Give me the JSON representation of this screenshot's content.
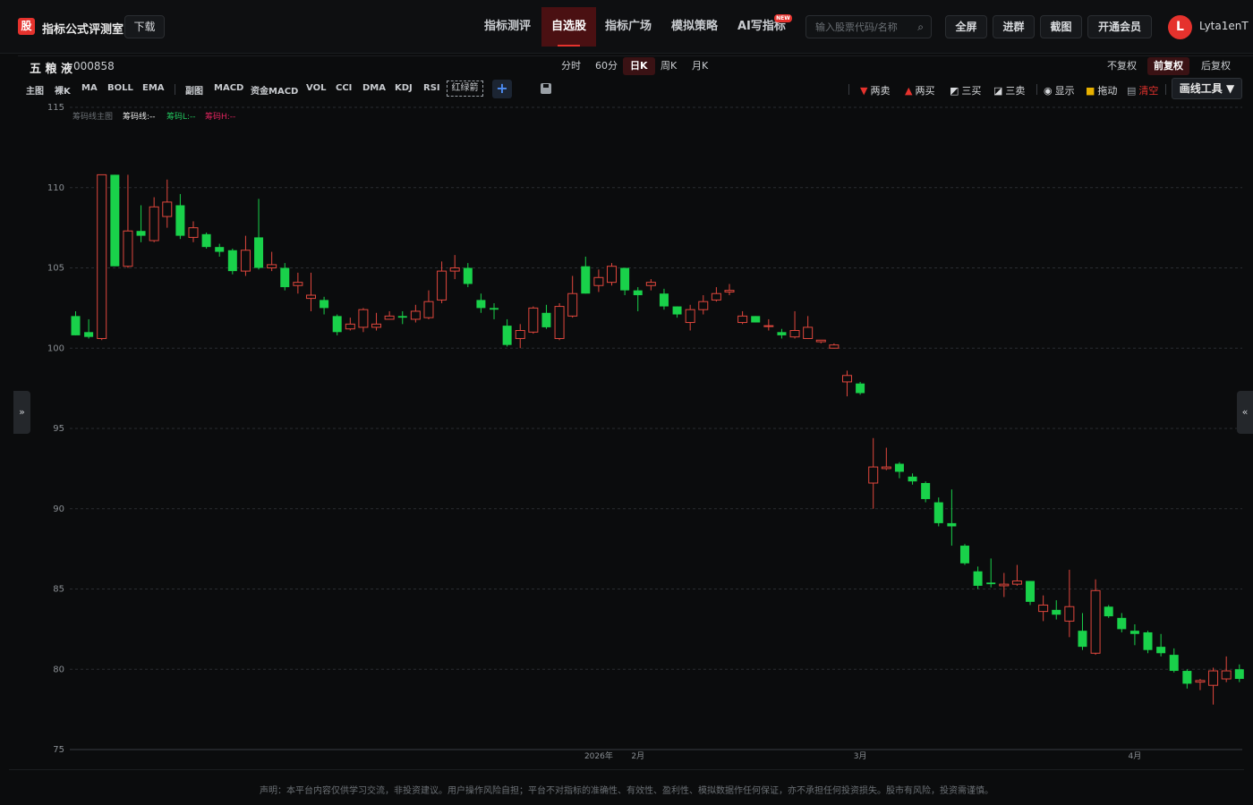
{
  "app": {
    "logo": "股",
    "title": "指标公式评测室",
    "download": "下载"
  },
  "nav": [
    {
      "label": "指标测评",
      "active": false
    },
    {
      "label": "自选股",
      "active": true
    },
    {
      "label": "指标广场",
      "active": false
    },
    {
      "label": "模拟策略",
      "active": false
    },
    {
      "label": "AI写指标",
      "active": false,
      "badge": "NEW"
    }
  ],
  "search": {
    "placeholder": "输入股票代码/名称"
  },
  "top_buttons": [
    "全屏",
    "进群",
    "截图",
    "开通会员"
  ],
  "user": {
    "initial": "L",
    "name": "Lyta1enT"
  },
  "stock": {
    "name": "五 粮 液",
    "code": "000858"
  },
  "periods": [
    {
      "label": "分时",
      "active": false
    },
    {
      "label": "60分",
      "active": false
    },
    {
      "label": "日K",
      "active": true
    },
    {
      "label": "周K",
      "active": false
    },
    {
      "label": "月K",
      "active": false
    }
  ],
  "adjust": [
    {
      "label": "不复权",
      "active": false
    },
    {
      "label": "前复权",
      "active": true
    },
    {
      "label": "后复权",
      "active": false
    }
  ],
  "indicators_main": [
    "主图",
    "裸K",
    "MA",
    "BOLL",
    "EMA"
  ],
  "indicators_sub": [
    "副图",
    "MACD",
    "资金MACD",
    "VOL",
    "CCI",
    "DMA",
    "KDJ",
    "RSI"
  ],
  "redgreen_label": "红绿箭",
  "plus_label": "+",
  "tools": [
    {
      "glyph": "▼",
      "color": "#e5322d",
      "label": "两卖"
    },
    {
      "glyph": "▲",
      "color": "#e5322d",
      "label": "两买"
    },
    {
      "glyph": "◩",
      "color": "#d7d9dc",
      "label": "三买"
    },
    {
      "glyph": "◪",
      "color": "#d7d9dc",
      "label": "三卖"
    },
    {
      "glyph": "◉",
      "color": "#d7d9dc",
      "label": "显示"
    },
    {
      "glyph": "🔒",
      "color": "#e8b100",
      "label": "拖动"
    },
    {
      "glyph": "🗑",
      "color": "#9aa0a6",
      "label": "清空",
      "label_color": "#e5322d"
    }
  ],
  "draw_tool": "画线工具 ▼",
  "side_left": "»",
  "side_right": "«",
  "legend": [
    {
      "label": "筹码线主图",
      "color": "#6b7075"
    },
    {
      "label": "筹码线:--",
      "color": "#e8e8e8"
    },
    {
      "label": "筹码L:--",
      "color": "#22c55e"
    },
    {
      "label": "筹码H:--",
      "color": "#e0245e"
    }
  ],
  "disclaimer": "声明：本平台内容仅供学习交流，非投资建议。用户操作风险自担；平台不对指标的准确性、有效性、盈利性、模拟数据作任何保证，亦不承担任何投资损失。股市有风险，投资需谨慎。",
  "colors": {
    "up": "#e0473d",
    "down": "#19d14a",
    "grid": "#2a2d31",
    "axis_text": "#8a8f94"
  },
  "chart_data": {
    "type": "candlestick",
    "y_ticks": [
      115,
      110,
      105,
      100,
      95,
      90,
      85,
      80,
      75
    ],
    "ylim": [
      75,
      115
    ],
    "x_labels": [
      {
        "index": 40,
        "label": "2026年"
      },
      {
        "index": 43,
        "label": "2月"
      },
      {
        "index": 60,
        "label": "3月"
      },
      {
        "index": 81,
        "label": "4月"
      }
    ],
    "candles": [
      [
        102.0,
        100.8,
        102.3,
        100.8
      ],
      [
        101.0,
        100.7,
        101.8,
        100.6
      ],
      [
        100.6,
        110.8,
        110.8,
        100.5
      ],
      [
        110.8,
        105.1,
        110.8,
        105.1
      ],
      [
        105.1,
        107.3,
        110.8,
        105.0
      ],
      [
        107.3,
        107.0,
        108.9,
        106.6
      ],
      [
        106.7,
        108.8,
        109.4,
        106.6
      ],
      [
        108.2,
        109.1,
        110.5,
        107.5
      ],
      [
        108.9,
        107.0,
        109.6,
        106.8
      ],
      [
        106.9,
        107.5,
        107.9,
        106.6
      ],
      [
        107.1,
        106.3,
        107.2,
        106.2
      ],
      [
        106.3,
        106.0,
        106.5,
        105.7
      ],
      [
        106.1,
        104.8,
        106.2,
        104.6
      ],
      [
        104.8,
        106.1,
        107.0,
        104.5
      ],
      [
        106.9,
        105.0,
        109.3,
        104.9
      ],
      [
        105.0,
        105.2,
        106.0,
        104.8
      ],
      [
        105.0,
        103.8,
        105.3,
        103.6
      ],
      [
        103.9,
        104.1,
        104.7,
        103.4
      ],
      [
        103.1,
        103.3,
        104.7,
        102.3
      ],
      [
        103.0,
        102.5,
        103.2,
        102.1
      ],
      [
        102.0,
        101.0,
        102.1,
        100.8
      ],
      [
        101.2,
        101.5,
        101.9,
        101.1
      ],
      [
        101.3,
        102.4,
        102.5,
        101.0
      ],
      [
        101.3,
        101.5,
        102.2,
        101.1
      ],
      [
        101.8,
        102.0,
        102.3,
        101.8
      ],
      [
        102.0,
        101.9,
        102.3,
        101.5
      ],
      [
        101.8,
        102.3,
        102.7,
        101.6
      ],
      [
        101.9,
        102.9,
        103.6,
        101.8
      ],
      [
        103.0,
        104.8,
        105.4,
        102.8
      ],
      [
        104.8,
        105.0,
        105.8,
        104.3
      ],
      [
        105.0,
        104.0,
        105.3,
        103.8
      ],
      [
        103.0,
        102.5,
        103.4,
        102.2
      ],
      [
        102.5,
        102.4,
        102.8,
        101.8
      ],
      [
        101.4,
        100.2,
        101.8,
        100.1
      ],
      [
        100.6,
        101.1,
        101.5,
        100.0
      ],
      [
        101.0,
        102.5,
        102.6,
        100.9
      ],
      [
        102.2,
        101.3,
        102.7,
        101.2
      ],
      [
        100.6,
        102.6,
        102.8,
        100.5
      ],
      [
        102.0,
        103.4,
        104.5,
        101.9
      ],
      [
        105.1,
        103.4,
        105.7,
        103.4
      ],
      [
        103.9,
        104.4,
        104.9,
        103.5
      ],
      [
        104.1,
        105.1,
        105.3,
        103.9
      ],
      [
        105.0,
        103.6,
        105.0,
        103.3
      ],
      [
        103.6,
        103.3,
        103.8,
        102.3
      ],
      [
        103.9,
        104.1,
        104.3,
        103.6
      ],
      [
        103.4,
        102.6,
        103.7,
        102.4
      ],
      [
        102.6,
        102.1,
        102.6,
        101.9
      ],
      [
        101.6,
        102.4,
        102.7,
        101.1
      ],
      [
        102.4,
        102.9,
        103.3,
        102.1
      ],
      [
        103.0,
        103.4,
        103.8,
        102.9
      ],
      [
        103.5,
        103.6,
        104.0,
        103.3
      ],
      [
        101.6,
        102.0,
        102.3,
        101.5
      ],
      [
        102.0,
        101.6,
        102.0,
        101.6
      ],
      [
        101.4,
        101.4,
        101.8,
        101.1
      ],
      [
        101.0,
        100.8,
        101.2,
        100.6
      ],
      [
        100.7,
        101.1,
        102.3,
        100.6
      ],
      [
        100.6,
        101.3,
        102.0,
        100.6
      ],
      [
        100.4,
        100.5,
        100.5,
        100.3
      ],
      [
        100.0,
        100.2,
        100.3,
        100.0
      ],
      [
        97.9,
        98.3,
        98.6,
        97.0
      ],
      [
        97.8,
        97.2,
        97.9,
        97.1
      ],
      [
        91.6,
        92.6,
        94.4,
        90.0
      ],
      [
        92.5,
        92.6,
        93.8,
        92.4
      ],
      [
        92.8,
        92.3,
        92.9,
        91.9
      ],
      [
        92.0,
        91.7,
        92.2,
        91.5
      ],
      [
        91.6,
        90.6,
        91.7,
        90.4
      ],
      [
        90.4,
        89.1,
        90.7,
        88.9
      ],
      [
        89.1,
        88.9,
        91.2,
        87.7
      ],
      [
        87.7,
        86.6,
        87.8,
        86.5
      ],
      [
        86.1,
        85.2,
        86.4,
        85.0
      ],
      [
        85.4,
        85.3,
        86.9,
        85.1
      ],
      [
        85.2,
        85.3,
        86.0,
        84.5
      ],
      [
        85.3,
        85.5,
        86.5,
        85.2
      ],
      [
        85.5,
        84.2,
        85.5,
        84.0
      ],
      [
        83.6,
        84.0,
        84.6,
        83.0
      ],
      [
        83.7,
        83.4,
        84.3,
        83.1
      ],
      [
        83.0,
        83.9,
        86.2,
        82.0
      ],
      [
        82.4,
        81.4,
        83.5,
        81.2
      ],
      [
        81.0,
        84.9,
        85.6,
        80.9
      ],
      [
        83.9,
        83.3,
        84.0,
        83.2
      ],
      [
        83.2,
        82.5,
        83.5,
        82.3
      ],
      [
        82.4,
        82.2,
        82.8,
        81.5
      ],
      [
        82.3,
        81.2,
        82.4,
        81.0
      ],
      [
        81.4,
        81.0,
        82.2,
        80.8
      ],
      [
        80.9,
        79.9,
        81.3,
        79.8
      ],
      [
        79.9,
        79.1,
        80.0,
        78.8
      ],
      [
        79.2,
        79.3,
        79.4,
        78.7
      ],
      [
        79.0,
        79.9,
        80.1,
        77.8
      ],
      [
        79.4,
        79.9,
        80.8,
        79.2
      ],
      [
        80.0,
        79.4,
        80.3,
        79.2
      ]
    ]
  }
}
